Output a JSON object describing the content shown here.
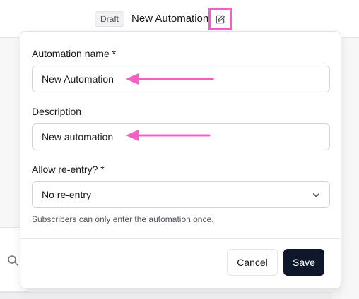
{
  "header": {
    "status_badge": "Draft",
    "title": "New Automation",
    "edit_icon": "pencil-edit-icon"
  },
  "form": {
    "name_label": "Automation name *",
    "name_value": "New Automation",
    "description_label": "Description",
    "description_value": "New automation",
    "reentry_label": "Allow re-entry? *",
    "reentry_selected": "No re-entry",
    "reentry_helper": "Subscribers can only enter the automation once."
  },
  "actions": {
    "cancel_label": "Cancel",
    "save_label": "Save"
  },
  "colors": {
    "annotation": "#f45fc5",
    "primary_button": "#0f172a"
  }
}
